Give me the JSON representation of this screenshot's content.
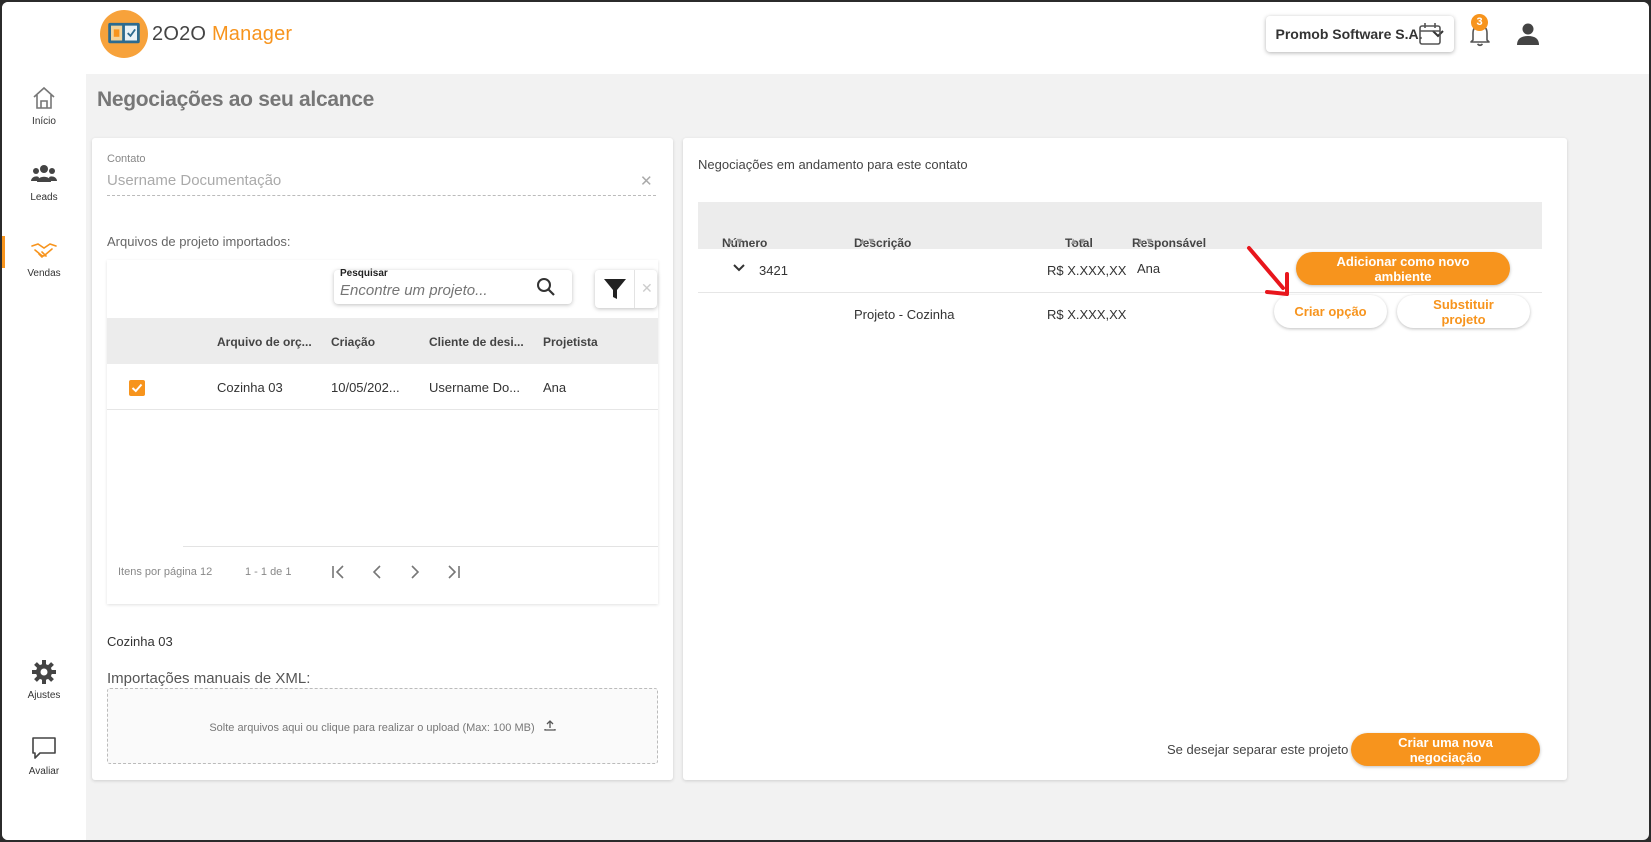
{
  "app": {
    "logo_brand": "2O2O",
    "logo_product": "Manager"
  },
  "sidebar": {
    "items": [
      {
        "label": "Início",
        "icon": "home-icon"
      },
      {
        "label": "Leads",
        "icon": "users-icon"
      },
      {
        "label": "Vendas",
        "icon": "handshake-icon"
      },
      {
        "label": "Ajustes",
        "icon": "gear-icon"
      },
      {
        "label": "Avaliar",
        "icon": "chat-icon"
      }
    ],
    "active": "Vendas"
  },
  "header": {
    "company": "Promob Software S.A.",
    "notifications_count": "3"
  },
  "page": {
    "title": "Negociações ao seu alcance"
  },
  "left": {
    "contact_label": "Contato",
    "contact_value": "Username Documentação",
    "imported_label": "Arquivos de projeto importados:",
    "search_label": "Pesquisar",
    "search_placeholder": "Encontre um projeto...",
    "columns": [
      "Arquivo de orç...",
      "Criação",
      "Cliente de desi...",
      "Projetista"
    ],
    "rows": [
      {
        "file": "Cozinha 03",
        "created": "10/05/202...",
        "client": "Username Do...",
        "designer": "Ana",
        "checked": true
      }
    ],
    "items_per_page": "Itens por página 12",
    "range": "1 - 1 de 1",
    "selected_file": "Cozinha 03",
    "xml_label": "Importações manuais de XML:",
    "dropzone_text": "Solte arquivos aqui ou clique para realizar o upload (Max: 100 MB)"
  },
  "right": {
    "title": "Negociações em andamento para este contato",
    "columns": [
      "Número",
      "Descrição",
      "Total",
      "Responsável"
    ],
    "negotiation": {
      "number": "3421",
      "total": "R$ X.XXX,XX",
      "responsible": "Ana",
      "add_button": "Adicionar como novo ambiente"
    },
    "project": {
      "description": "Projeto - Cozinha",
      "total": "R$ X.XXX,XX",
      "option_button": "Criar opção",
      "replace_button": "Substituir projeto"
    },
    "footer_text": "Se desejar separar este projeto",
    "new_negotiation_button": "Criar uma nova negociação"
  },
  "colors": {
    "accent": "#f7941d",
    "annotation_arrow": "#e8161c"
  }
}
